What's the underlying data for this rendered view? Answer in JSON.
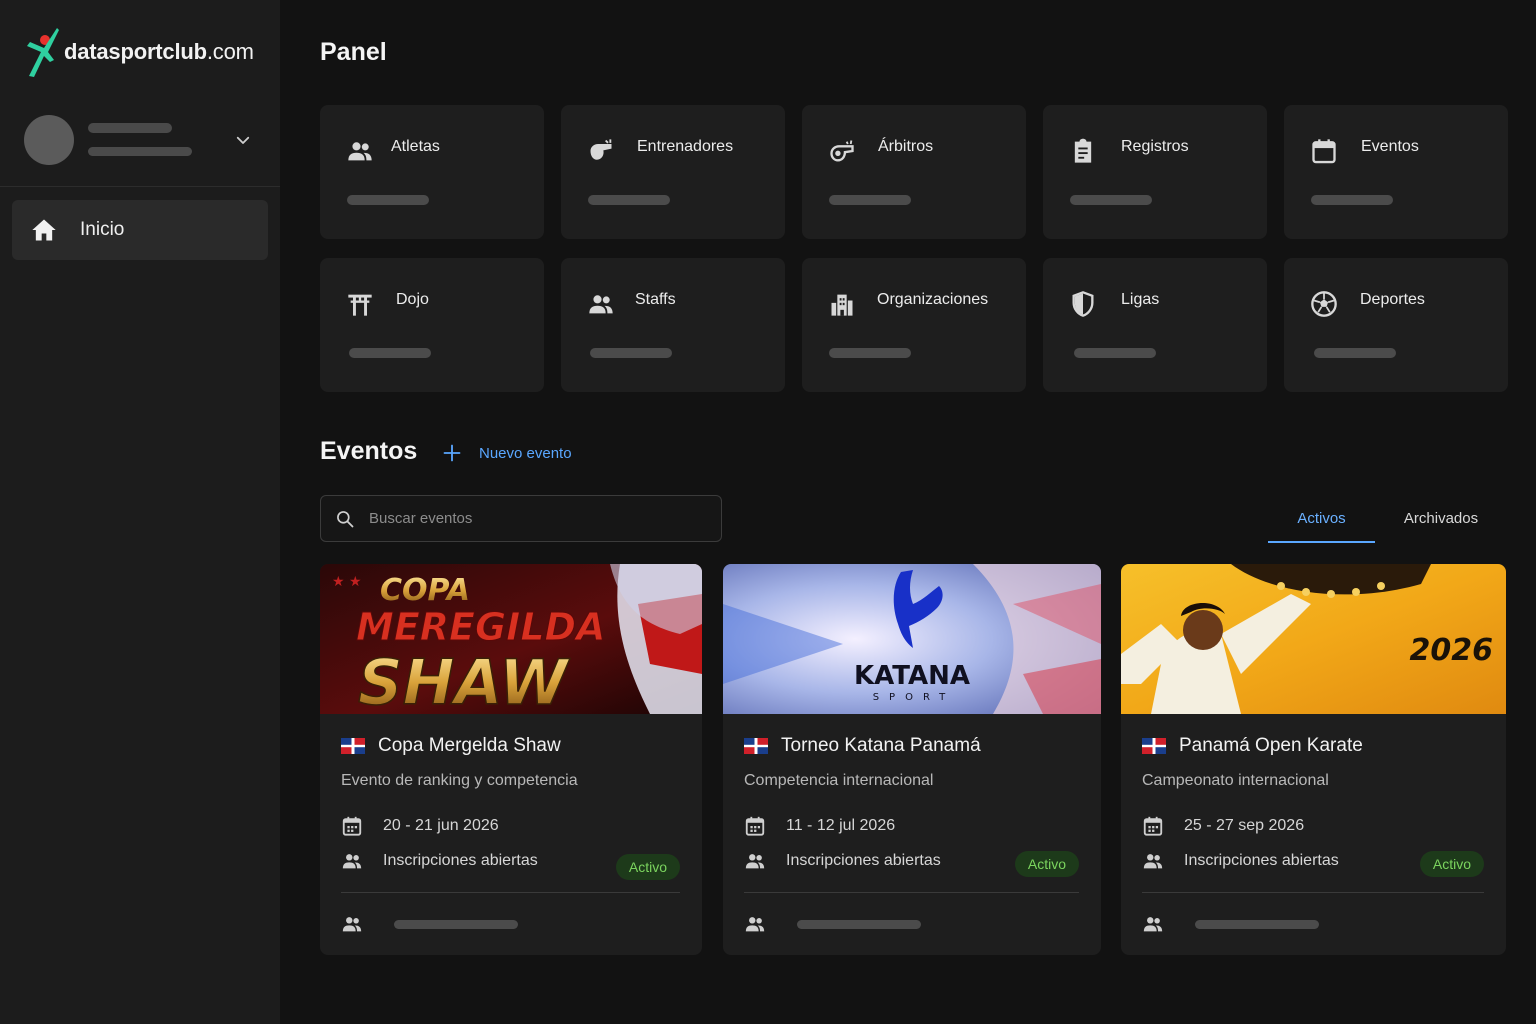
{
  "brand": {
    "logo_bold": "datasportclub",
    "logo_suffix": ".com",
    "accent": "#2fd0a0"
  },
  "sidebar": {
    "nav": [
      {
        "label": "Inicio",
        "icon": "home-icon"
      }
    ]
  },
  "panel": {
    "title": "Panel",
    "tiles": [
      {
        "label": "Atletas",
        "icon": "people-icon"
      },
      {
        "label": "Entrenadores",
        "icon": "coach-whistle-icon"
      },
      {
        "label": "Árbitros",
        "icon": "whistle-icon"
      },
      {
        "label": "Registros",
        "icon": "clipboard-icon"
      },
      {
        "label": "Eventos",
        "icon": "calendar-icon"
      },
      {
        "label": "Dojo",
        "icon": "torii-icon"
      },
      {
        "label": "Staffs",
        "icon": "people-icon"
      },
      {
        "label": "Organizaciones",
        "icon": "building-icon"
      },
      {
        "label": "Ligas",
        "icon": "shield-icon"
      },
      {
        "label": "Deportes",
        "icon": "soccer-ball-icon"
      }
    ]
  },
  "events": {
    "title": "Eventos",
    "new_event_label": "Nuevo evento",
    "search_placeholder": "Buscar eventos",
    "tabs": {
      "active": "Activos",
      "archived": "Archivados"
    },
    "cards": [
      {
        "banner_text": [
          "COPA",
          "MEREGILDA",
          "SHAW"
        ],
        "title": "Copa Mergelda Shaw",
        "subtitle": "Evento de ranking y competencia",
        "dates": "20 - 21 jun 2026",
        "registration": "Inscripciones abiertas",
        "status": "Activo"
      },
      {
        "banner_text": [
          "KATANA",
          "SPORT"
        ],
        "title": "Torneo Katana Panamá",
        "subtitle": "Competencia internacional",
        "dates": "11 - 12 jul 2026",
        "registration": "Inscripciones abiertas",
        "status": "Activo"
      },
      {
        "banner_text": [
          "2026"
        ],
        "title": "Panamá Open Karate",
        "subtitle": "Campeonato internacional",
        "dates": "25 - 27 sep 2026",
        "registration": "Inscripciones abiertas",
        "status": "Activo"
      }
    ]
  }
}
